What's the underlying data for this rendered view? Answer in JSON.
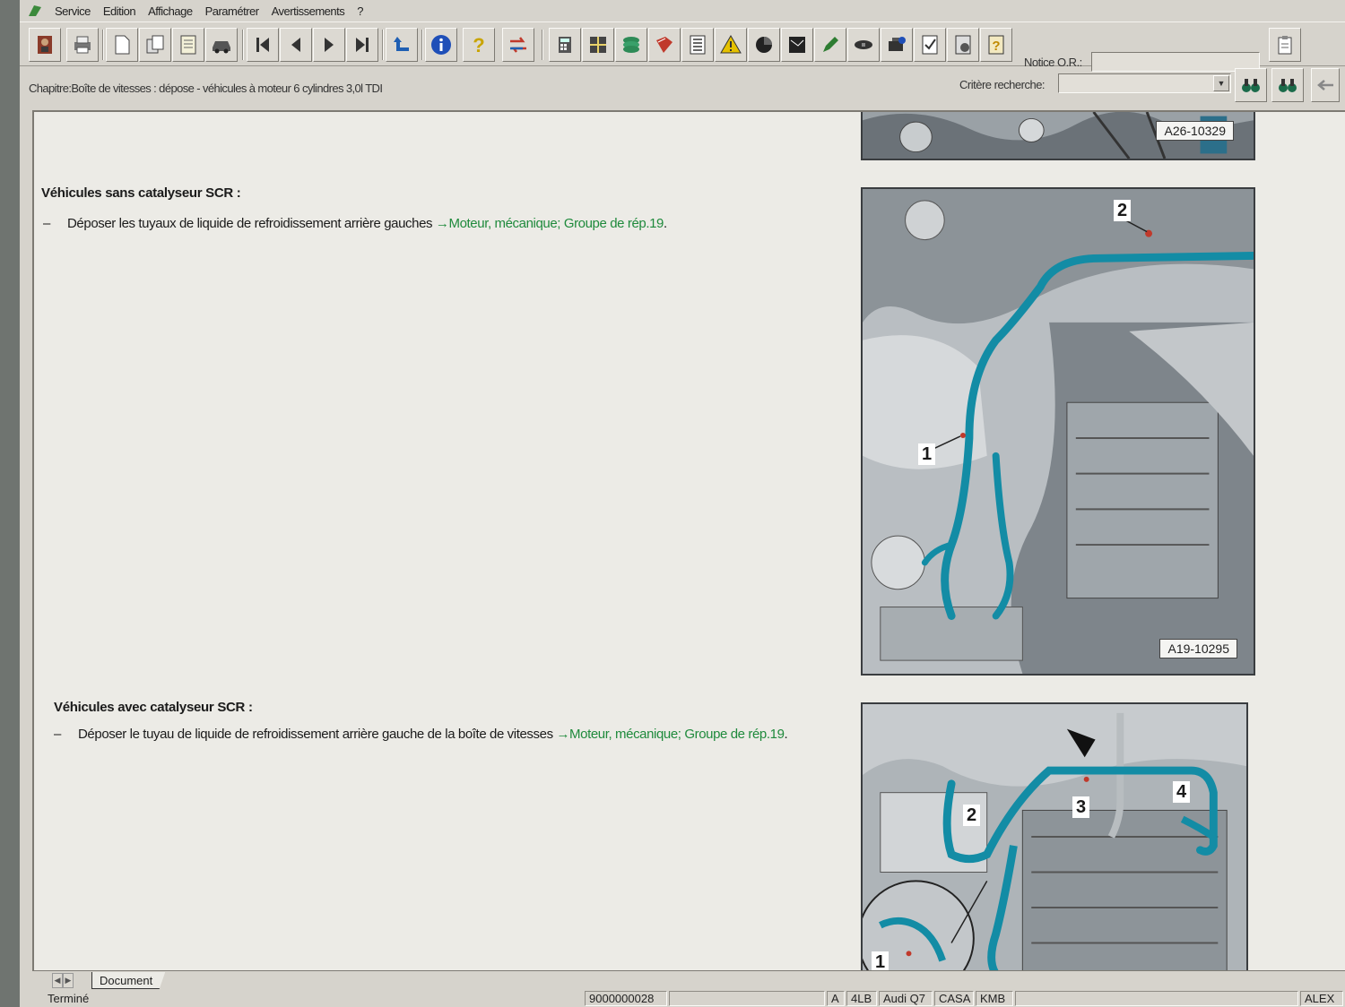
{
  "menu": {
    "items": [
      "Service",
      "Edition",
      "Affichage",
      "Paramétrer",
      "Avertissements",
      "?"
    ]
  },
  "toolbar": {
    "buttons": [
      "repair-manual-icon",
      "print-icon",
      "new-document-icon",
      "copy-document-icon",
      "notes-icon",
      "vehicle-icon",
      "first-page-icon",
      "previous-page-icon",
      "next-page-icon",
      "last-page-icon",
      "back-icon",
      "info-icon",
      "help-icon",
      "swap-icon",
      "calculator-icon",
      "grid-icon",
      "layers-icon",
      "book-icon",
      "list-icon",
      "warning-icon",
      "globe-icon",
      "diagram-icon",
      "pencil-icon",
      "key-icon",
      "engine-icon",
      "checklist-icon",
      "settings-icon",
      "question-doc-icon"
    ],
    "notice_label": "Notice O.R.:",
    "notice_value": ""
  },
  "chapter_bar": {
    "chapter_text": "Chapitre:Boîte de vitesses : dépose - véhicules à moteur 6 cylindres 3,0l TDI",
    "criteria_label": "Critère recherche:",
    "criteria_value": ""
  },
  "document": {
    "section1": {
      "heading": "Véhicules sans catalyseur SCR :",
      "dash": "–",
      "text": "Déposer les tuyaux de liquide de refroidissement arrière gauches ",
      "link": "→Moteur, mécanique; Groupe de rép.19",
      "suffix": "."
    },
    "section2": {
      "heading": "Véhicules avec catalyseur SCR :",
      "dash": "–",
      "text": "Déposer le tuyau de liquide de refroidissement arrière gauche de la boîte de vitesses ",
      "link": "→Moteur, mécanique; Groupe de rép.19",
      "suffix": "."
    },
    "figure_top": {
      "id": "A26-10329"
    },
    "figure_middle": {
      "id": "A19-10295",
      "callouts": [
        "1",
        "2"
      ]
    },
    "figure_bottom": {
      "callouts": [
        "1",
        "2",
        "3",
        "4"
      ]
    }
  },
  "tabs": {
    "active": "Document"
  },
  "status_bar": {
    "status": "Terminé",
    "order_number": "9000000028",
    "field_a": "A",
    "engine_code": "4LB",
    "model": "Audi Q7",
    "code_casa": "CASA",
    "code_kmb": "KMB",
    "user": "ALEX"
  },
  "colors": {
    "hose": "#138ca5",
    "link": "#1f8a3c",
    "window_bg": "#d6d3cc",
    "document_bg": "#ecebe6"
  }
}
